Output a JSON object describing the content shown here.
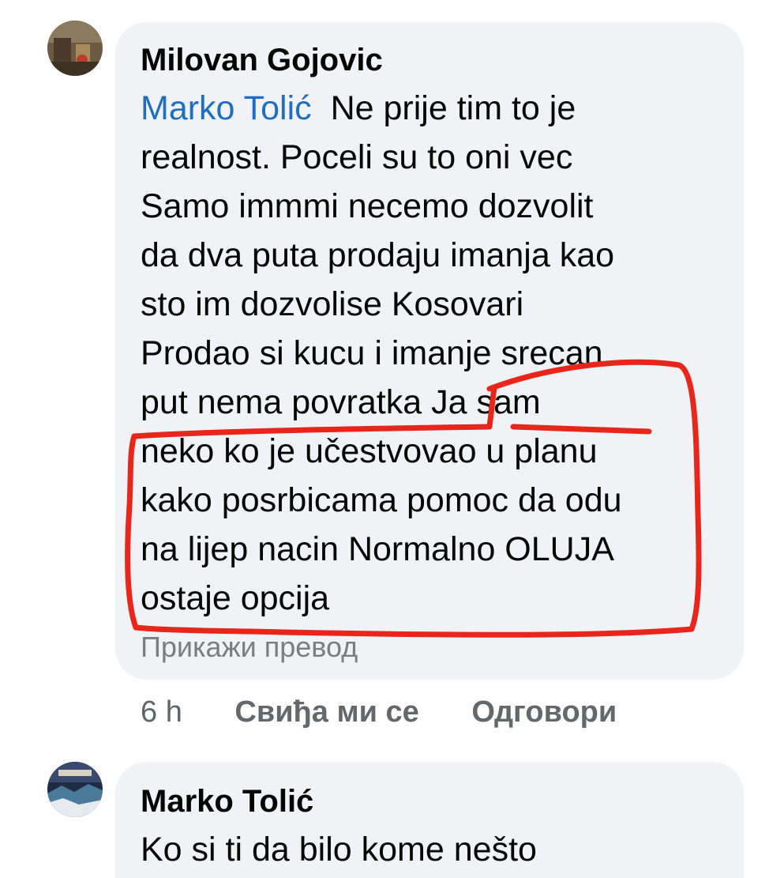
{
  "comments": [
    {
      "author": "Milovan Gojovic",
      "mention": "Marko Tolić",
      "lines": [
        "Ne prije tim to je",
        "realnost. Poceli su to oni vec",
        "Samo immmi necemo dozvolit",
        "da dva puta prodaju imanja kao",
        "sto im dozvolise Kosovari",
        "Prodao si kucu i imanje srecan",
        "put  nema povratka  Ja sam",
        "neko ko je učestvovao u planu",
        "kako posrbicama pomoc da odu",
        "na lijep nacin Normalno OLUJA",
        "ostaje opcija"
      ],
      "translate_label": "Прикажи превод",
      "actions": {
        "time": "6 h",
        "like_label": "Свиђа ми се",
        "reply_label": "Одговори"
      }
    },
    {
      "author": "Marko Tolić",
      "lines": [
        "Ko si ti da bilo kome nešto"
      ]
    }
  ],
  "colors": {
    "bubble_bg": "#f0f2f5",
    "mention": "#1f6fbf",
    "annotation_marker": "#e8261c",
    "secondary_text": "#65676b"
  }
}
